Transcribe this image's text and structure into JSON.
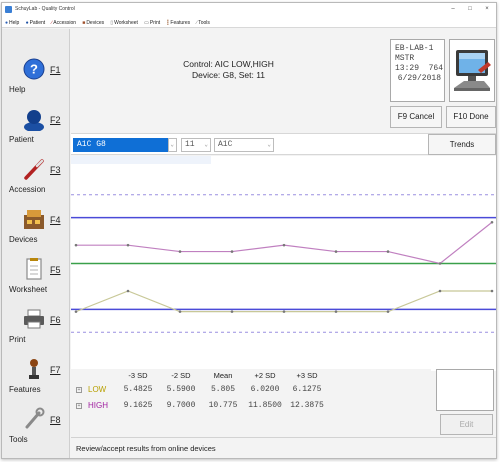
{
  "window": {
    "title": "SchuyLab - Quality Control",
    "controls": [
      "–",
      "□",
      "×"
    ]
  },
  "menu": [
    {
      "label": "Help",
      "icon": "help-icon",
      "glyph": "●",
      "color": "#2a5fb6"
    },
    {
      "label": "Patient",
      "icon": "patient-icon",
      "glyph": "●",
      "color": "#1b4fa3"
    },
    {
      "label": "Accession",
      "icon": "accession-icon",
      "glyph": "∕",
      "color": "#b22222"
    },
    {
      "label": "Devices",
      "icon": "devices-icon",
      "glyph": "■",
      "color": "#a0522d"
    },
    {
      "label": "Worksheet",
      "icon": "worksheet-icon",
      "glyph": "▯",
      "color": "#777777"
    },
    {
      "label": "Print",
      "icon": "print-icon",
      "glyph": "▭",
      "color": "#555555"
    },
    {
      "label": "Features",
      "icon": "features-icon",
      "glyph": "┇",
      "color": "#8b4513"
    },
    {
      "label": "Tools",
      "icon": "tools-icon",
      "glyph": "∕",
      "color": "#777777"
    }
  ],
  "sidebar": [
    {
      "key": "F1",
      "label": "Help",
      "icon": "help-icon"
    },
    {
      "key": "F2",
      "label": "Patient",
      "icon": "patient-icon"
    },
    {
      "key": "F3",
      "label": "Accession",
      "icon": "accession-icon"
    },
    {
      "key": "F4",
      "label": "Devices",
      "icon": "devices-icon"
    },
    {
      "key": "F5",
      "label": "Worksheet",
      "icon": "worksheet-icon"
    },
    {
      "key": "F6",
      "label": "Print",
      "icon": "print-icon"
    },
    {
      "key": "F7",
      "label": "Features",
      "icon": "features-icon"
    },
    {
      "key": "F8",
      "label": "Tools",
      "icon": "tools-icon"
    }
  ],
  "control": {
    "line1": "Control: AIC LOW,HIGH",
    "line2": "Device: G8, Set: 11"
  },
  "status_box": {
    "line1": "EB-LAB-1",
    "line2": "MSTR",
    "line3": "13:29  764",
    "line4": "6/29/2018"
  },
  "buttons": {
    "cancel": "F9 Cancel",
    "done": "F10 Done",
    "trends": "Trends",
    "edit": "Edit"
  },
  "filters": {
    "test_device": "A1C      G8",
    "set": "11",
    "analyte": "A1C"
  },
  "chart_data": {
    "type": "line",
    "x": [
      1,
      2,
      3,
      4,
      5,
      6,
      7,
      8,
      9
    ],
    "series": [
      {
        "name": "HIGH",
        "color": "#c080c0",
        "values": [
          0.8,
          0.8,
          0.52,
          0.52,
          0.8,
          0.52,
          0.52,
          0.0,
          1.8
        ]
      },
      {
        "name": "LOW",
        "color": "#c8c898",
        "values": [
          -2.1,
          -1.2,
          -2.1,
          -2.1,
          -2.1,
          -2.1,
          -2.1,
          -1.2,
          -1.2
        ]
      }
    ],
    "reference_lines": {
      "sd3": {
        "values": [
          -3,
          3
        ],
        "color": "#9a8fe0",
        "style": "dashed"
      },
      "sd2": {
        "values": [
          -2,
          2
        ],
        "color": "#4a4ad8",
        "style": "solid"
      },
      "mean": {
        "value": 0,
        "color": "#3aa04a",
        "style": "solid"
      }
    },
    "ylim": [
      -3.6,
      3.6
    ]
  },
  "stats": {
    "headers": [
      "-3 SD",
      "-2 SD",
      "Mean",
      "+2 SD",
      "+3 SD"
    ],
    "rows": [
      {
        "name": "LOW",
        "color": "#b8a000",
        "values": [
          "5.4825",
          "5.5900",
          "5.805",
          "6.0200",
          "6.1275"
        ]
      },
      {
        "name": "HIGH",
        "color": "#a020a0",
        "values": [
          "9.1625",
          "9.7000",
          "10.775",
          "11.8500",
          "12.3875"
        ]
      }
    ]
  },
  "status_message": "Review/accept results from online devices"
}
